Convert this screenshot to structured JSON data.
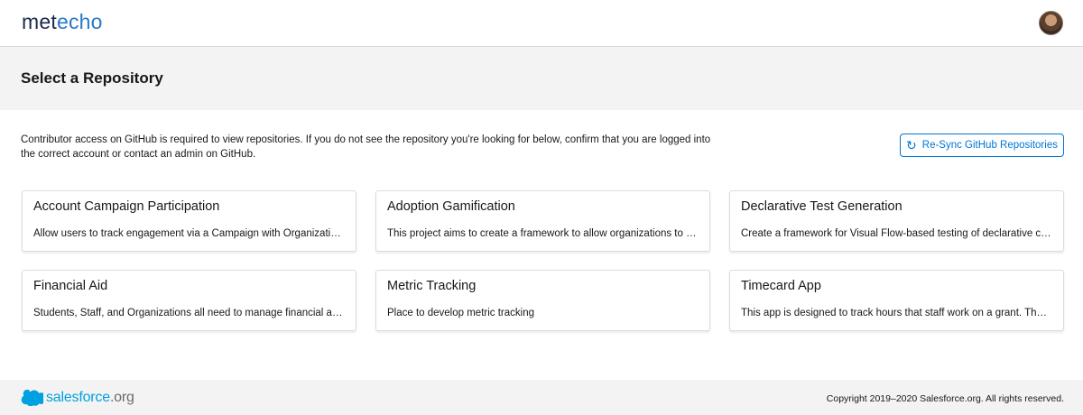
{
  "header": {
    "logo_part1": "met",
    "logo_part2": "echo",
    "avatar_icon": "user-avatar"
  },
  "page": {
    "title": "Select a Repository",
    "intro": "Contributor access on GitHub is required to view repositories. If you do not see the repository you're looking for below, confirm that you are logged into the correct account or contact an admin on GitHub.",
    "resync_label": "Re-Sync GitHub Repositories",
    "resync_icon": "refresh-icon"
  },
  "repositories": [
    {
      "name": "Account Campaign Participation",
      "description": "Allow users to track engagement via a Campaign with Organization A..."
    },
    {
      "name": "Adoption Gamification",
      "description": "This project aims to create a framework to allow organizations to crea..."
    },
    {
      "name": "Declarative Test Generation",
      "description": "Create a framework for Visual Flow-based testing of declarative custo..."
    },
    {
      "name": "Financial Aid",
      "description": "Students, Staff, and Organizations all need to manage financial aid. T..."
    },
    {
      "name": "Metric Tracking",
      "description": "Place to develop metric tracking"
    },
    {
      "name": "Timecard App",
      "description": "This app is designed to track hours that staff work on a grant. The ho..."
    }
  ],
  "footer": {
    "brand_main": "salesforce",
    "brand_suffix": ".org",
    "copyright": "Copyright 2019–2020 Salesforce.org. All rights reserved."
  },
  "colors": {
    "accent": "#0176d3",
    "logo_dark": "#1b2a4b",
    "logo_blue": "#2a79c8",
    "salesforce_blue": "#00a1e0",
    "band_gray": "#f3f3f3"
  }
}
